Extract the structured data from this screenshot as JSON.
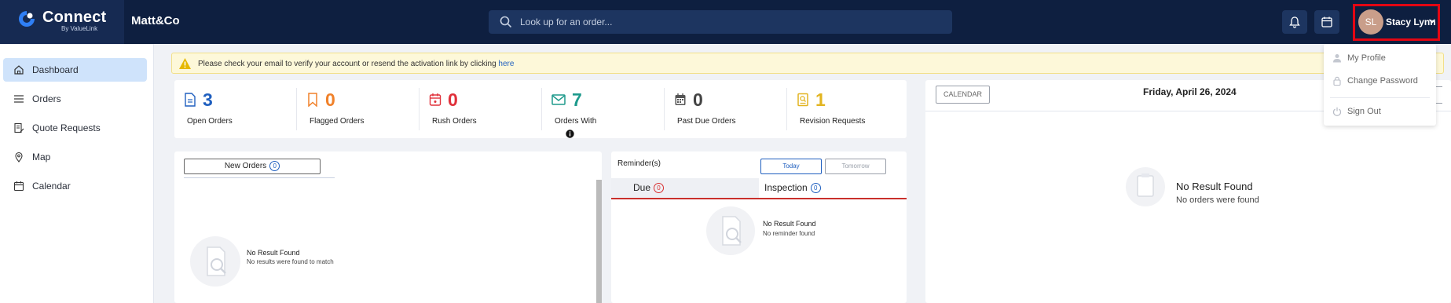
{
  "app": {
    "logo_text": "Connect",
    "logo_subtext": "By ValueLink",
    "company": "Matt&Co"
  },
  "search": {
    "placeholder": "Look up for an order..."
  },
  "user": {
    "initials": "SL",
    "name": "Stacy Lynn"
  },
  "sidebar": {
    "items": [
      {
        "label": "Dashboard",
        "icon": "home-icon",
        "active": true
      },
      {
        "label": "Orders",
        "icon": "list-icon"
      },
      {
        "label": "Quote Requests",
        "icon": "quote-icon"
      },
      {
        "label": "Map",
        "icon": "map-pin-icon"
      },
      {
        "label": "Calendar",
        "icon": "calendar-icon"
      }
    ]
  },
  "alert": {
    "text": "Please check your email to verify your account or resend the activation link by clicking ",
    "link": "here"
  },
  "stats": [
    {
      "value": "3",
      "label": "Open Orders",
      "icon": "document-icon",
      "color": "#1f5fbf"
    },
    {
      "value": "0",
      "label": "Flagged Orders",
      "icon": "bookmark-icon",
      "color": "#f0812a"
    },
    {
      "value": "0",
      "label": "Rush Orders",
      "icon": "calendar-alert-icon",
      "color": "#e0303a"
    },
    {
      "value": "7",
      "label": "Orders With",
      "icon": "mail-icon",
      "color": "#1e9a8c"
    },
    {
      "value": "0",
      "label": "Past Due Orders",
      "icon": "calendar-grid-icon",
      "color": "#444444"
    },
    {
      "value": "1",
      "label": "Revision Requests",
      "icon": "search-doc-icon",
      "color": "#e2b420"
    }
  ],
  "orders": {
    "tab_label": "New Orders",
    "tab_count": "0",
    "empty_title": "No Result Found",
    "empty_sub": "No results were found to match"
  },
  "reminders": {
    "title": "Reminder(s)",
    "today_label": "Today",
    "tomorrow_label": "Tomorrow",
    "due_label": "Due",
    "due_count": "0",
    "inspection_label": "Inspection",
    "inspection_count": "0",
    "empty_title": "No Result Found",
    "empty_sub": "No reminder found"
  },
  "calendar": {
    "button_label": "CALENDAR",
    "date": "Friday, April 26, 2024",
    "empty_title": "No Result Found",
    "empty_sub": "No orders were found"
  },
  "user_menu": {
    "items": [
      {
        "label": "My Profile",
        "icon": "person-icon"
      },
      {
        "label": "Change Password",
        "icon": "lock-icon"
      },
      {
        "label": "Sign Out",
        "icon": "power-icon"
      }
    ]
  },
  "colors": {
    "topbar": "#0e1f40",
    "accent": "#1f5fbf",
    "highlight_border": "#e30613",
    "active_nav": "#cfe3fb"
  }
}
